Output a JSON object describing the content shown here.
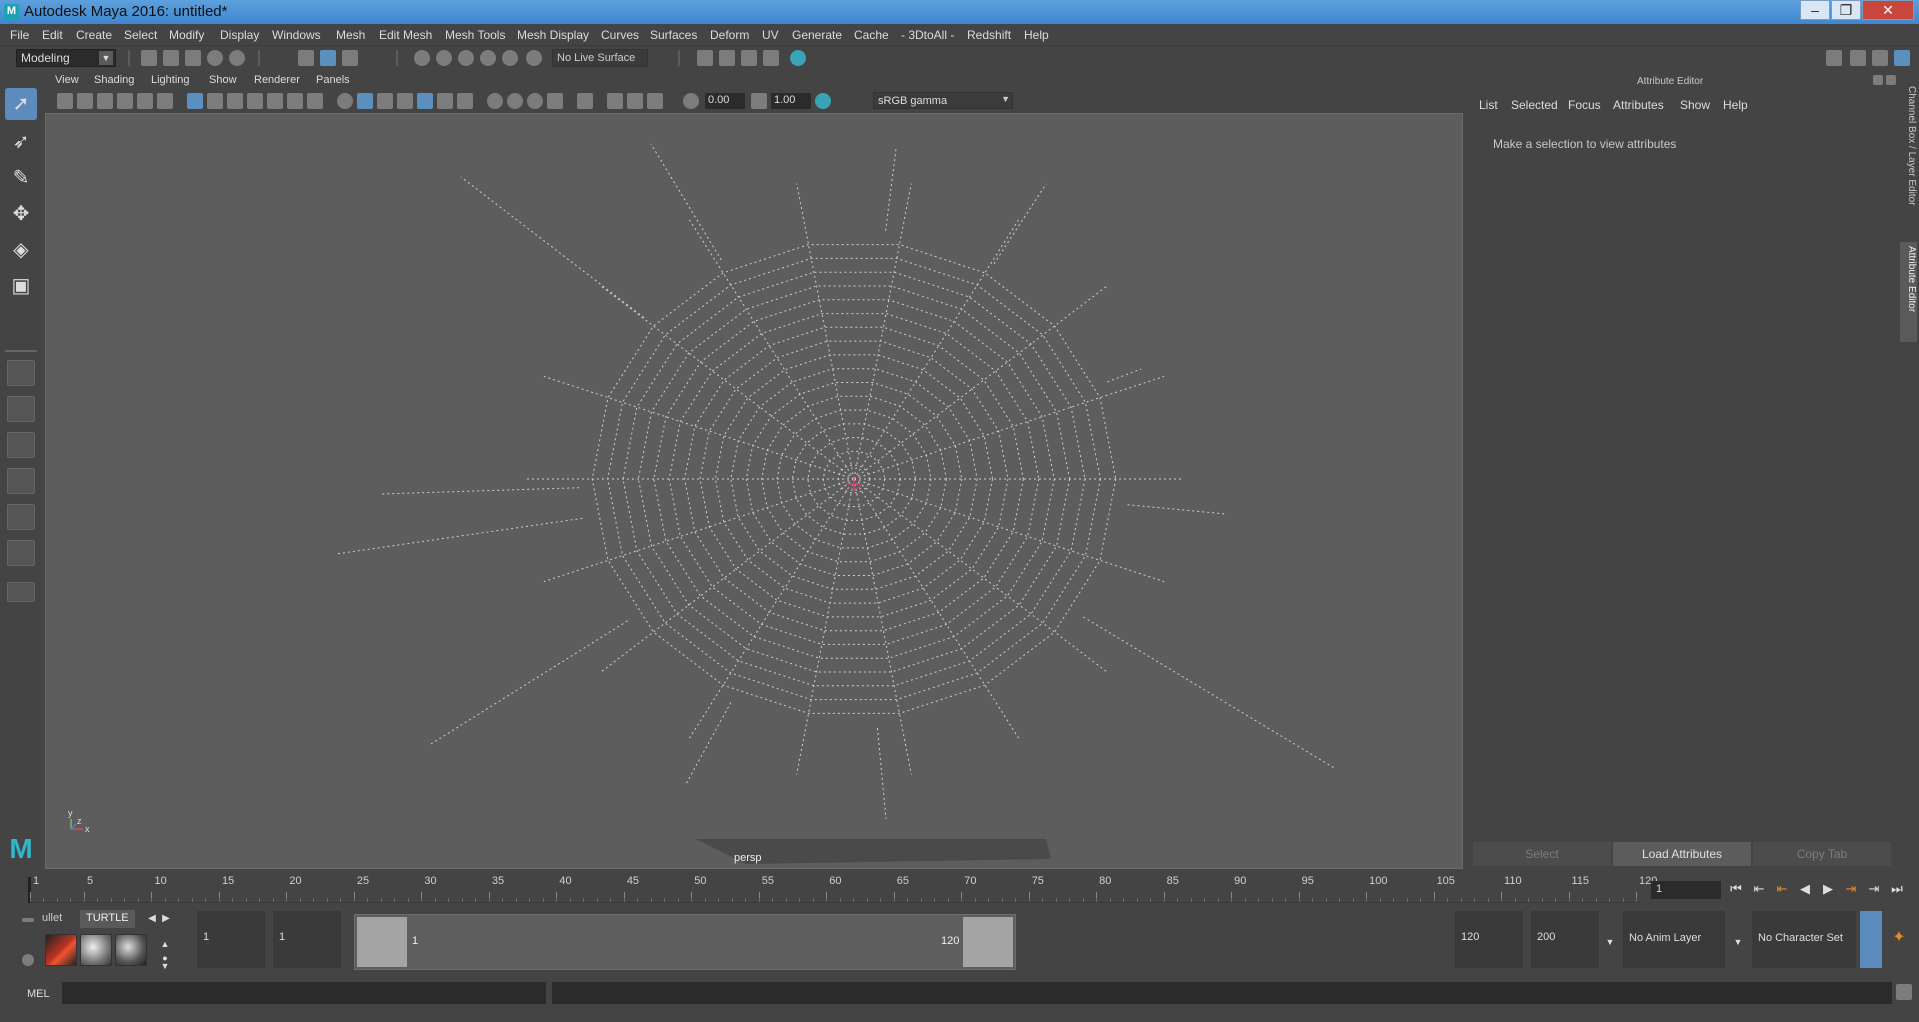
{
  "window": {
    "title": "Autodesk Maya 2016: untitled*",
    "minimize": "–",
    "restore": "❐",
    "close": "✕"
  },
  "menu": [
    "File",
    "Edit",
    "Create",
    "Select",
    "Modify",
    "Display",
    "Windows",
    "Mesh",
    "Edit Mesh",
    "Mesh Tools",
    "Mesh Display",
    "Curves",
    "Surfaces",
    "Deform",
    "UV",
    "Generate",
    "Cache",
    "- 3DtoAll -",
    "Redshift",
    "Help"
  ],
  "shelf": {
    "mode": "Modeling",
    "live_surface": "No Live Surface"
  },
  "panel_menu": [
    "View",
    "Shading",
    "Lighting",
    "Show",
    "Renderer",
    "Panels"
  ],
  "viewport_toolbar": {
    "exposure": "0.00",
    "gamma_value": "1.00",
    "color_space": "sRGB gamma"
  },
  "viewport": {
    "camera": "persp",
    "axis_y": "y",
    "axis_x": "x",
    "axis_z": "z"
  },
  "attribute_editor": {
    "title": "Attribute Editor",
    "menu": [
      "List",
      "Selected",
      "Focus",
      "Attributes",
      "Show",
      "Help"
    ],
    "message": "Make a selection to view attributes",
    "buttons": [
      "Select",
      "Load Attributes",
      "Copy Tab"
    ]
  },
  "side_tabs": [
    "Channel Box / Layer Editor",
    "Attribute Editor"
  ],
  "timeline": {
    "ticks": [
      1,
      5,
      10,
      15,
      20,
      25,
      30,
      35,
      40,
      45,
      50,
      55,
      60,
      65,
      70,
      75,
      80,
      85,
      90,
      95,
      100,
      105,
      110,
      115,
      120
    ],
    "current_frame": "1"
  },
  "range": {
    "shelf_tabs": [
      "ullet",
      "TURTLE"
    ],
    "start": "1",
    "inner_start": "1",
    "slider_start": "1",
    "slider_end": "120",
    "end": "120",
    "anim_end": "200",
    "anim_layer": "No Anim Layer",
    "character_set": "No Character Set"
  },
  "command": {
    "label": "MEL"
  },
  "colors": {
    "accent": "#5d8bbd",
    "viewport_bg": "#5d5d5d",
    "web_line": "#cfcfcf"
  }
}
